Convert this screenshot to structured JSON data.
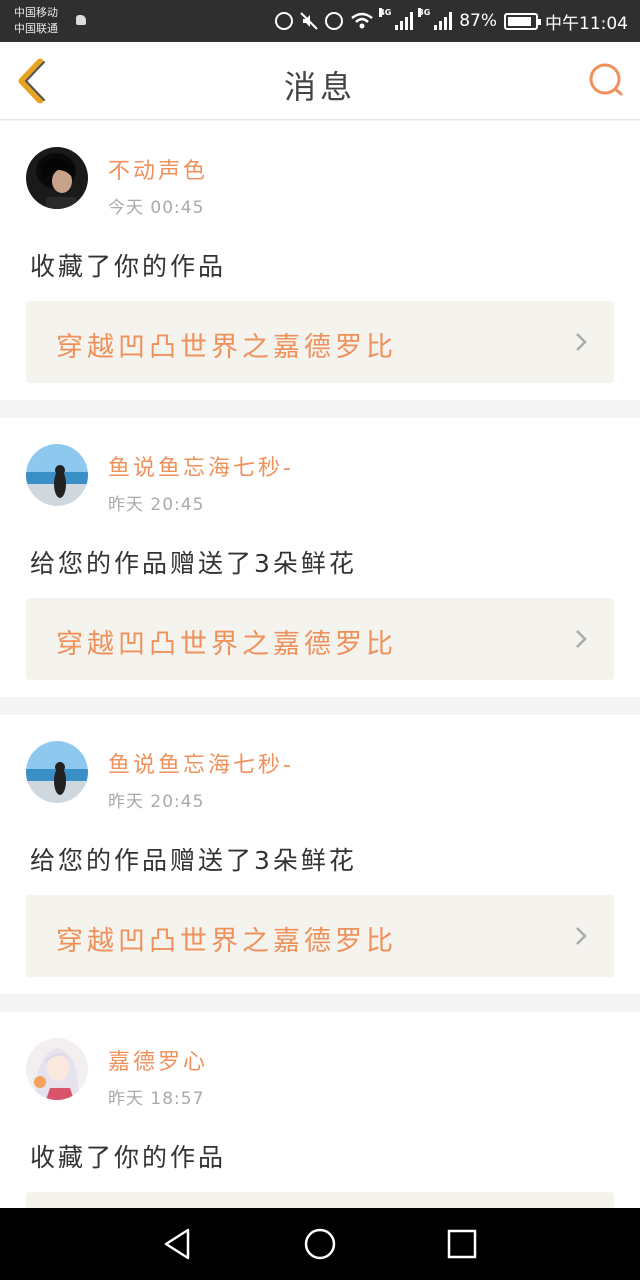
{
  "status_bar": {
    "carrier1": "中国移动",
    "carrier2": "中国联通",
    "network1": "4G",
    "network2": "3G",
    "battery": "87%",
    "battery_level": 0.87,
    "time": "中午11:04"
  },
  "header": {
    "title": "消息"
  },
  "colors": {
    "accent": "#f0905a",
    "card_link_bg": "#f4f3ee"
  },
  "messages": [
    {
      "user": "不动声色",
      "time": "今天 00:45",
      "action": "收藏了你的作品",
      "work": "穿越凹凸世界之嘉德罗比"
    },
    {
      "user": "鱼说鱼忘海七秒-",
      "time": "昨天 20:45",
      "action": "给您的作品赠送了3朵鲜花",
      "work": "穿越凹凸世界之嘉德罗比"
    },
    {
      "user": "鱼说鱼忘海七秒-",
      "time": "昨天 20:45",
      "action": "给您的作品赠送了3朵鲜花",
      "work": "穿越凹凸世界之嘉德罗比"
    },
    {
      "user": "嘉德罗心",
      "time": "昨天 18:57",
      "action": "收藏了你的作品"
    }
  ]
}
